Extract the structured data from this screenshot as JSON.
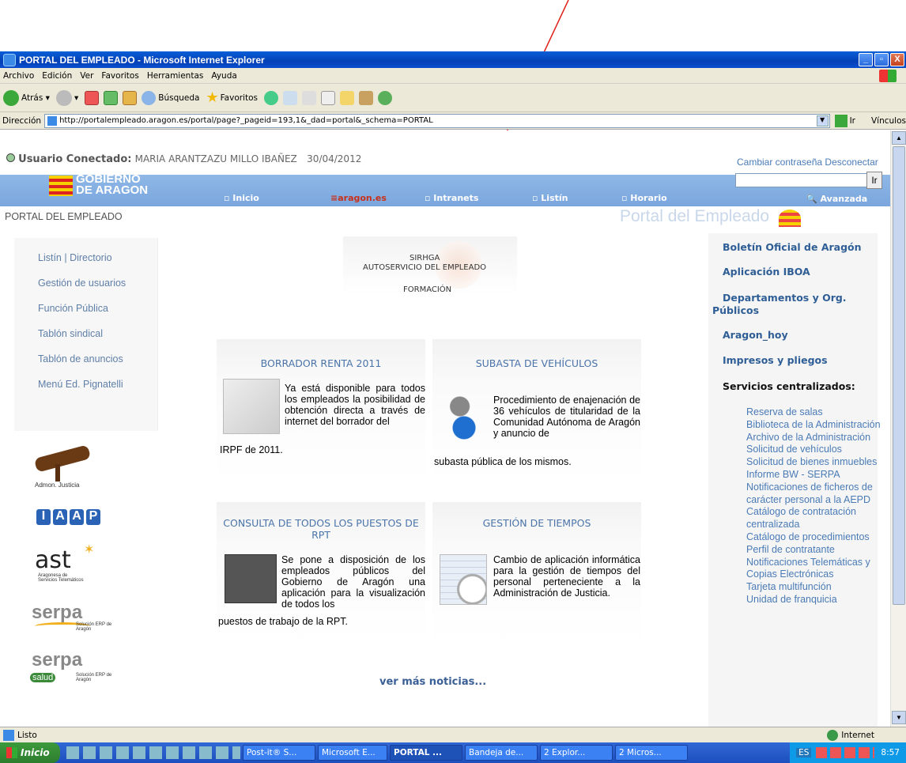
{
  "window": {
    "title": "PORTAL DEL EMPLEADO - Microsoft Internet Explorer",
    "buttons": [
      "_",
      "▫",
      "X"
    ]
  },
  "menubar": [
    "Archivo",
    "Edición",
    "Ver",
    "Favoritos",
    "Herramientas",
    "Ayuda"
  ],
  "toolbar": {
    "back": "Atrás",
    "search": "Búsqueda",
    "favorites": "Favoritos"
  },
  "address": {
    "label": "Dirección",
    "url": "http://portalempleado.aragon.es/portal/page?_pageid=193,1&_dad=portal&_schema=PORTAL",
    "go": "Ir",
    "links": "Vínculos"
  },
  "header": {
    "user_label": "Usuario Conectado:",
    "user_name": "MARIA ARANTZAZU MILLO IBAÑEZ",
    "date": "30/04/2012",
    "change_password": "Cambiar contraseña",
    "logout": "Desconectar",
    "search_button": "Ir",
    "advanced": "Avanzada",
    "logo_line1": "GOBIERNO",
    "logo_line2": "DE ARAGON",
    "breadcrumb": "PORTAL DEL EMPLEADO",
    "portal_watermark": "Portal del Empleado"
  },
  "nav": {
    "inicio": "Inicio",
    "aragon": "aragon.es",
    "intranets": "Intranets",
    "listin": "Listín",
    "horario": "Horario"
  },
  "left_links": [
    "Listín | Directorio",
    "Gestión de usuarios",
    "Función Pública",
    "Tablón sindical",
    "Tablón de anuncios",
    "Menú Ed. Pignatelli"
  ],
  "left_logos": {
    "justicia": "Admon. Justicia",
    "iaap": [
      "I",
      "A",
      "A",
      "P"
    ],
    "ast": "ast",
    "ast_sub": "Aragonesa de Servicios Telemáticos",
    "serpa": "serpa",
    "serpa_sub": "Solución ERP de Aragón",
    "salud": "salud"
  },
  "center_top": {
    "sirhga": "SIRHGA",
    "autoservicio": "AUTOSERVICIO DEL EMPLEADO",
    "formacion": "FORMACIÓN"
  },
  "news": [
    {
      "title": "BORRADOR RENTA 2011",
      "text_main": "Ya está disponible para todos los empleados la posibilidad de obtención directa a través de internet del borrador del",
      "text_tail": "IRPF de 2011."
    },
    {
      "title": "SUBASTA DE VEHÍCULOS",
      "text_main": "Procedimiento de enajenación de 36 vehículos de titularidad de la Comunidad Autónoma de Aragón y anuncio de",
      "text_tail": "subasta pública de los mismos."
    },
    {
      "title": "CONSULTA DE TODOS LOS PUESTOS DE RPT",
      "text_main": "Se pone a disposición de los empleados públicos del Gobierno de Aragón una aplicación para la visualización de todos los",
      "text_tail": "puestos de trabajo de la RPT."
    },
    {
      "title": "GESTIÓN DE TIEMPOS",
      "text_main": "Cambio de aplicación informática para la gestión de tiempos del personal perteneciente a la Administración de Justicia.",
      "text_tail": ""
    }
  ],
  "more_news": "ver más noticias...",
  "right_links": [
    "Boletín Oficial de Aragón",
    "Aplicación IBOA",
    "Departamentos y Org.",
    "Públicos",
    "Aragon_hoy",
    "Impresos y pliegos"
  ],
  "services_title": "Servicios centralizados:",
  "services": [
    "Reserva de salas",
    "Biblioteca de la Administración",
    "Archivo de la Administración",
    "Solicitud de vehículos",
    "Solicitud de bienes inmuebles",
    "Informe BW - SERPA",
    "Notificaciones de ficheros de carácter personal a la AEPD",
    "Catálogo de contratación centralizada",
    "Catálogo de procedimientos",
    "Perfil de contratante",
    "Notificaciones Telemáticas y Copias Electrónicas",
    "Tarjeta multifunción",
    "Unidad de franquicia"
  ],
  "status": {
    "text": "Listo",
    "zone": "Internet"
  },
  "taskbar": {
    "start": "Inicio",
    "tasks": [
      "Post-it® S...",
      "Microsoft E...",
      "PORTAL ...",
      "Bandeja de...",
      "2 Explor...",
      "2 Micros..."
    ],
    "lang": "ES",
    "clock": "8:57"
  },
  "colors": {
    "nav_blue": "#7aa6de",
    "link_blue": "#4a7bb7",
    "title_blue": "#0a4ecf"
  }
}
